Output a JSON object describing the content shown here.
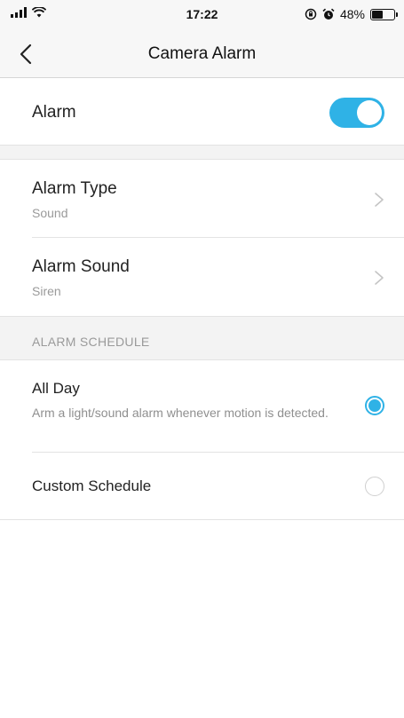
{
  "status_bar": {
    "time": "17:22",
    "battery_text": "48%",
    "battery_level": 0.48
  },
  "nav": {
    "title": "Camera Alarm",
    "back_icon": "chevron-left-icon"
  },
  "alarm": {
    "label": "Alarm",
    "enabled": true,
    "accent_color": "#2fb2e6"
  },
  "settings": {
    "alarm_type": {
      "title": "Alarm Type",
      "value": "Sound"
    },
    "alarm_sound": {
      "title": "Alarm Sound",
      "value": "Siren"
    }
  },
  "schedule": {
    "header": "ALARM SCHEDULE",
    "options": [
      {
        "title": "All Day",
        "description": "Arm a light/sound alarm whenever motion is detected.",
        "selected": true
      },
      {
        "title": "Custom Schedule",
        "selected": false
      }
    ]
  }
}
